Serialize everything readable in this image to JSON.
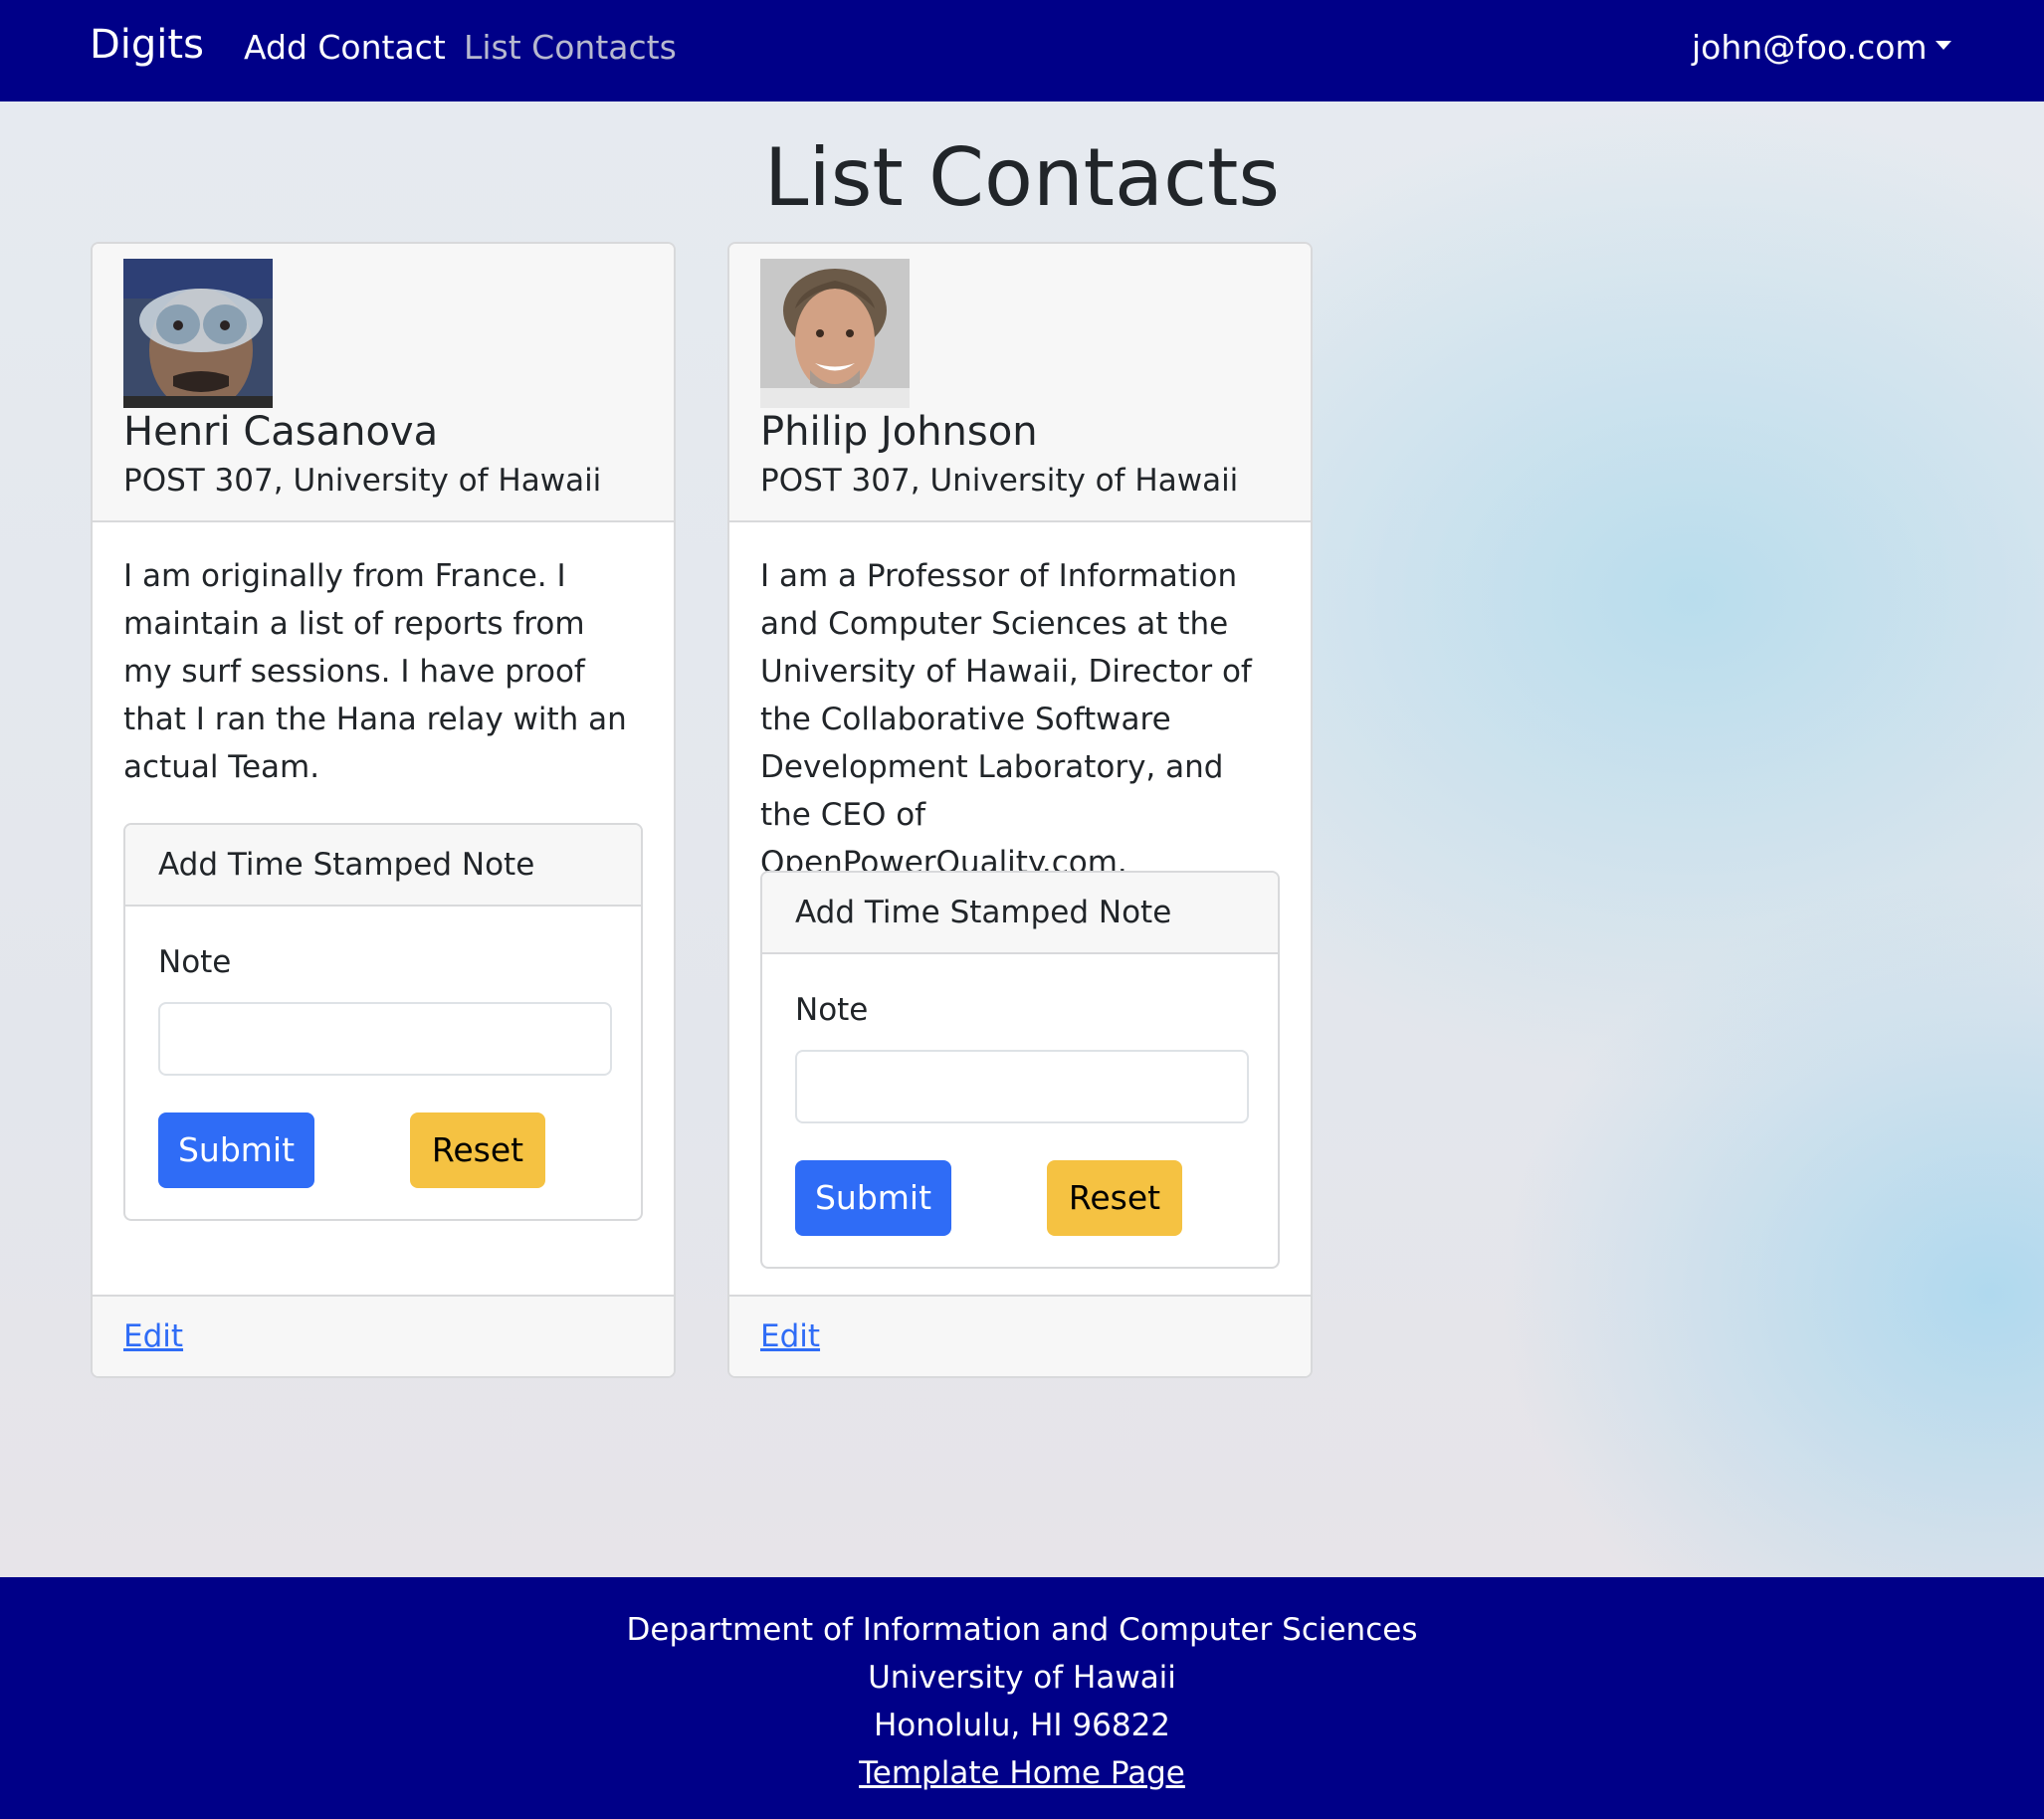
{
  "navbar": {
    "brand": "Digits",
    "links": [
      "Add Contact",
      "List Contacts"
    ],
    "user": "john@foo.com"
  },
  "page_title": "List Contacts",
  "contacts": [
    {
      "name": "Henri Casanova",
      "address": "POST 307, University of Hawaii",
      "description": "I am originally from France. I maintain a list of reports from my surf sessions. I have proof that I ran the Hana relay with an actual Team.",
      "note_form": {
        "title": "Add Time Stamped Note",
        "label": "Note",
        "value": "",
        "submit": "Submit",
        "reset": "Reset"
      },
      "edit": "Edit"
    },
    {
      "name": "Philip Johnson",
      "address": "POST 307, University of Hawaii",
      "description": "I am a Professor of Information and Computer Sciences at the University of Hawaii, Director of the Collaborative Software Development Laboratory, and the CEO of OpenPowerQuality.com.",
      "note_form": {
        "title": "Add Time Stamped Note",
        "label": "Note",
        "value": "",
        "submit": "Submit",
        "reset": "Reset"
      },
      "edit": "Edit"
    }
  ],
  "footer": {
    "line1": "Department of Information and Computer Sciences",
    "line2": "University of Hawaii",
    "line3": "Honolulu, HI 96822",
    "link": "Template Home Page"
  },
  "colors": {
    "navbar": "#000088",
    "primary": "#2f6cf6",
    "warning": "#f5c242"
  }
}
